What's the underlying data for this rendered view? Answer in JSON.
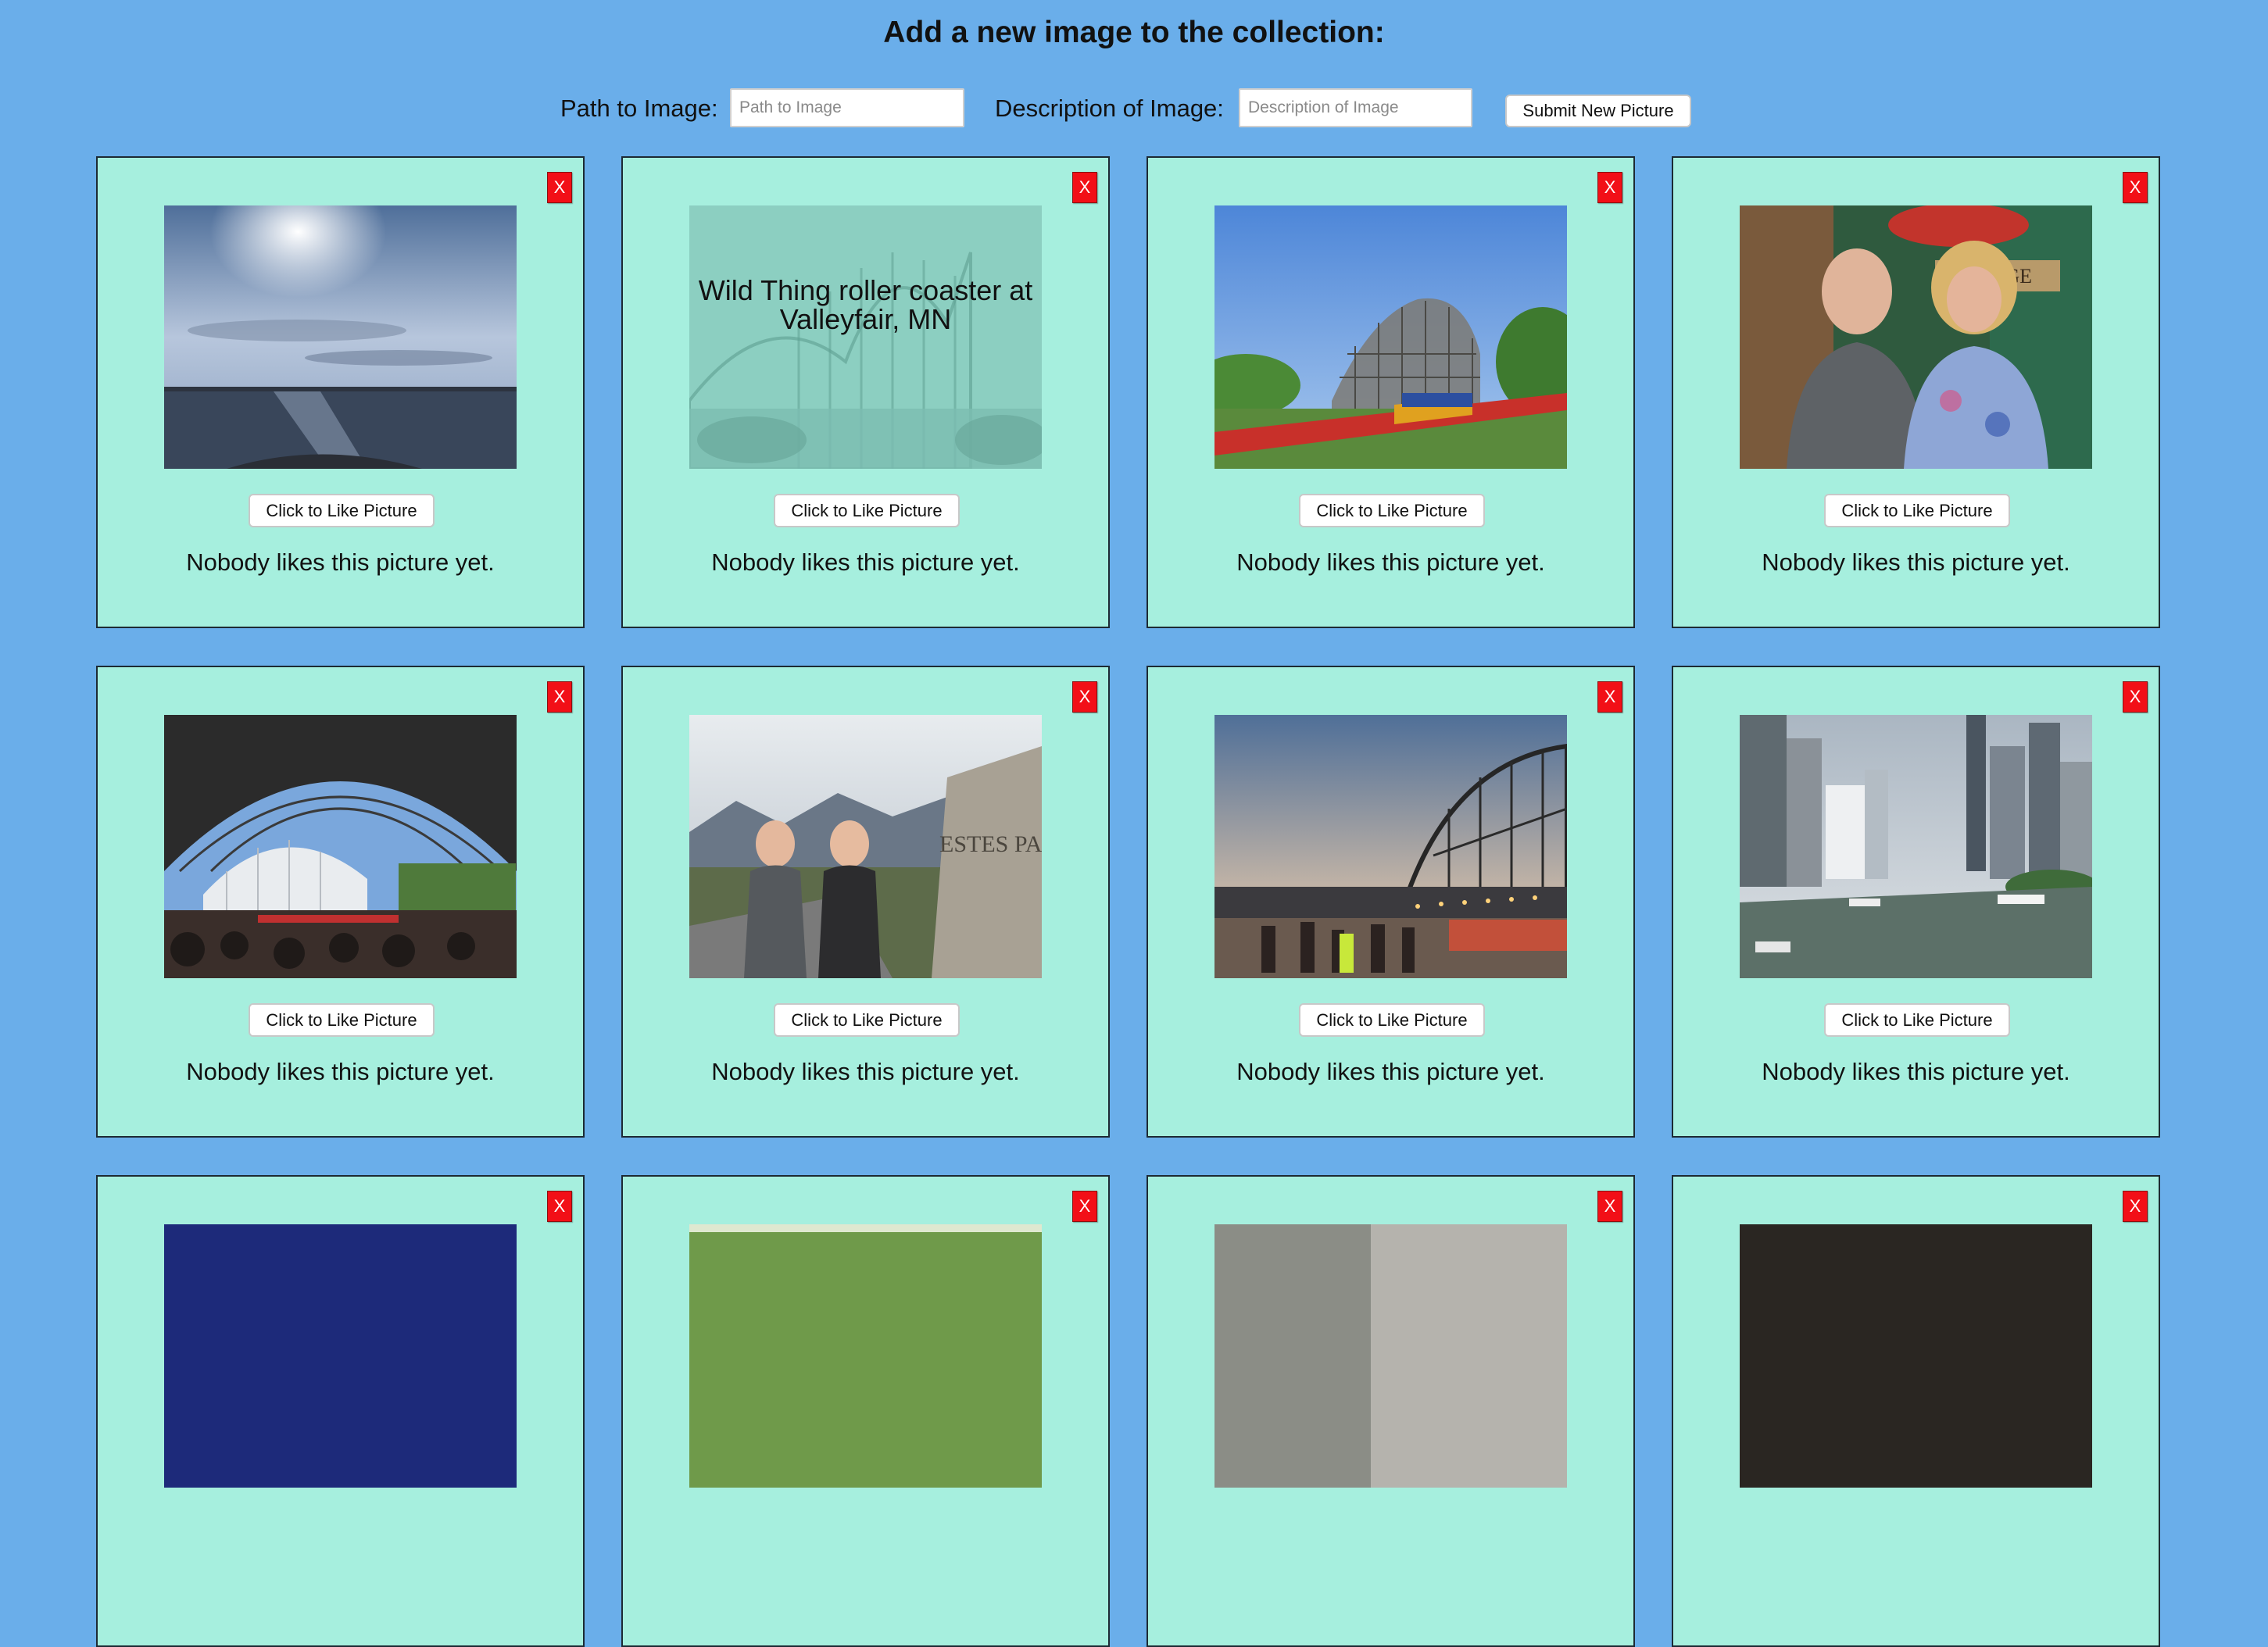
{
  "header": {
    "title": "Add a new image to the collection:"
  },
  "form": {
    "path_label": "Path to Image:",
    "path_placeholder": "Path to Image",
    "path_value": "",
    "desc_label": "Description of Image:",
    "desc_placeholder": "Description of Image",
    "desc_value": "",
    "submit_label": "Submit New Picture"
  },
  "cards": [
    {
      "close": "X",
      "like": "Click to Like Picture",
      "status": "Nobody likes this picture yet.",
      "alt": ""
    },
    {
      "close": "X",
      "like": "Click to Like Picture",
      "status": "Nobody likes this picture yet.",
      "alt": "Wild Thing roller coaster at Valleyfair, MN"
    },
    {
      "close": "X",
      "like": "Click to Like Picture",
      "status": "Nobody likes this picture yet.",
      "alt": ""
    },
    {
      "close": "X",
      "like": "Click to Like Picture",
      "status": "Nobody likes this picture yet.",
      "alt": ""
    },
    {
      "close": "X",
      "like": "Click to Like Picture",
      "status": "Nobody likes this picture yet.",
      "alt": ""
    },
    {
      "close": "X",
      "like": "Click to Like Picture",
      "status": "Nobody likes this picture yet.",
      "alt": ""
    },
    {
      "close": "X",
      "like": "Click to Like Picture",
      "status": "Nobody likes this picture yet.",
      "alt": ""
    },
    {
      "close": "X",
      "like": "Click to Like Picture",
      "status": "Nobody likes this picture yet.",
      "alt": ""
    },
    {
      "close": "X"
    },
    {
      "close": "X"
    },
    {
      "close": "X"
    },
    {
      "close": "X"
    }
  ],
  "photo_signs": {
    "estes": "ESTES PA",
    "lodge": "LODGE"
  },
  "colors": {
    "background": "#6aaeea",
    "card": "#a6efde",
    "close_button": "#f20f17"
  }
}
